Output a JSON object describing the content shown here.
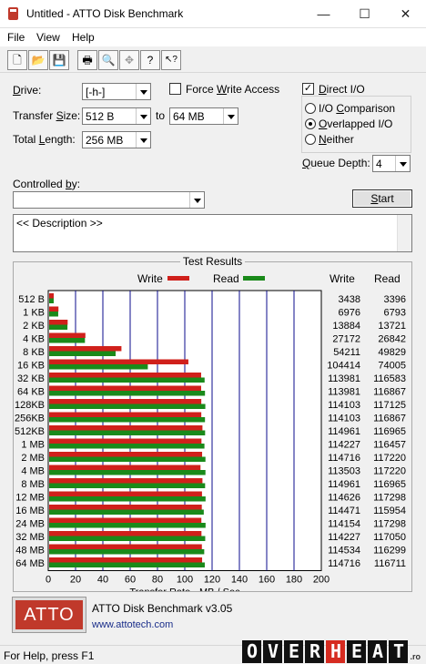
{
  "window": {
    "title": "Untitled - ATTO Disk Benchmark"
  },
  "menu": [
    "File",
    "View",
    "Help"
  ],
  "toolbar": [
    {
      "icon": "new-file-icon",
      "glyph": "🗋"
    },
    {
      "icon": "open-folder-icon",
      "glyph": "📂"
    },
    {
      "icon": "save-icon",
      "glyph": "💾"
    },
    {
      "icon": "print-icon",
      "glyph": "🖶"
    },
    {
      "icon": "print-preview-icon",
      "glyph": "🔍"
    },
    {
      "icon": "move-icon",
      "glyph": "✥"
    },
    {
      "icon": "help-icon",
      "glyph": "?"
    },
    {
      "icon": "context-help-icon",
      "glyph": "↖?"
    }
  ],
  "settings": {
    "drive_label": "Drive:",
    "drive_value": "[-h-]",
    "transfer_size_label": "Transfer Size:",
    "transfer_from": "512 B",
    "to_label": "to",
    "transfer_to": "64 MB",
    "total_length_label": "Total Length:",
    "total_length_value": "256 MB",
    "force_write_label": "Force Write Access",
    "force_write_checked": false,
    "direct_io_label": "Direct I/O",
    "direct_io_checked": true,
    "io_comparison_label": "I/O Comparison",
    "overlapped_io_label": "Overlapped I/O",
    "neither_label": "Neither",
    "selected_io_mode": "Overlapped I/O",
    "queue_depth_label": "Queue Depth:",
    "queue_depth_value": "4",
    "controlled_by_label": "Controlled by:",
    "controlled_by_value": "",
    "start_label": "Start",
    "description_text": "<< Description >>"
  },
  "results": {
    "title": "Test Results",
    "write_legend": "Write",
    "read_legend": "Read",
    "write_col": "Write",
    "read_col": "Read",
    "write_color": "#d0201b",
    "read_color": "#1a8a1a"
  },
  "chart_data": {
    "type": "bar",
    "orientation": "horizontal",
    "xlabel": "Transfer Rate - MB / Sec",
    "xlim": [
      0,
      200
    ],
    "xticks": [
      "0",
      "20",
      "40",
      "60",
      "80",
      "100",
      "120",
      "140",
      "160",
      "180",
      "200"
    ],
    "grid": true,
    "categories": [
      "512 B",
      "1 KB",
      "2 KB",
      "4 KB",
      "8 KB",
      "16 KB",
      "32 KB",
      "64 KB",
      "128KB",
      "256KB",
      "512KB",
      "1 MB",
      "2 MB",
      "4 MB",
      "8 MB",
      "12 MB",
      "16 MB",
      "24 MB",
      "32 MB",
      "48 MB",
      "64 MB"
    ],
    "series": [
      {
        "name": "Write",
        "values_kb": [
          "3438",
          "6976",
          "13884",
          "27172",
          "54211",
          "104414",
          "113981",
          "113981",
          "114103",
          "114103",
          "114961",
          "114227",
          "114716",
          "113503",
          "114961",
          "114626",
          "114471",
          "114154",
          "114227",
          "114534",
          "114716"
        ]
      },
      {
        "name": "Read",
        "values_kb": [
          "3396",
          "6793",
          "13721",
          "26842",
          "49829",
          "74005",
          "116583",
          "116867",
          "117125",
          "116867",
          "116965",
          "116457",
          "117220",
          "117220",
          "116965",
          "117298",
          "115954",
          "117298",
          "117050",
          "116299",
          "116711"
        ]
      }
    ]
  },
  "footer": {
    "logo_text": "ATTO",
    "product": "ATTO Disk Benchmark v3.05",
    "link": "www.attotech.com"
  },
  "status": {
    "text": "For Help, press F1"
  },
  "watermark": {
    "letters": [
      "O",
      "V",
      "E",
      "R",
      "H",
      "E",
      "A",
      "T"
    ],
    "suffix": ".ro"
  }
}
